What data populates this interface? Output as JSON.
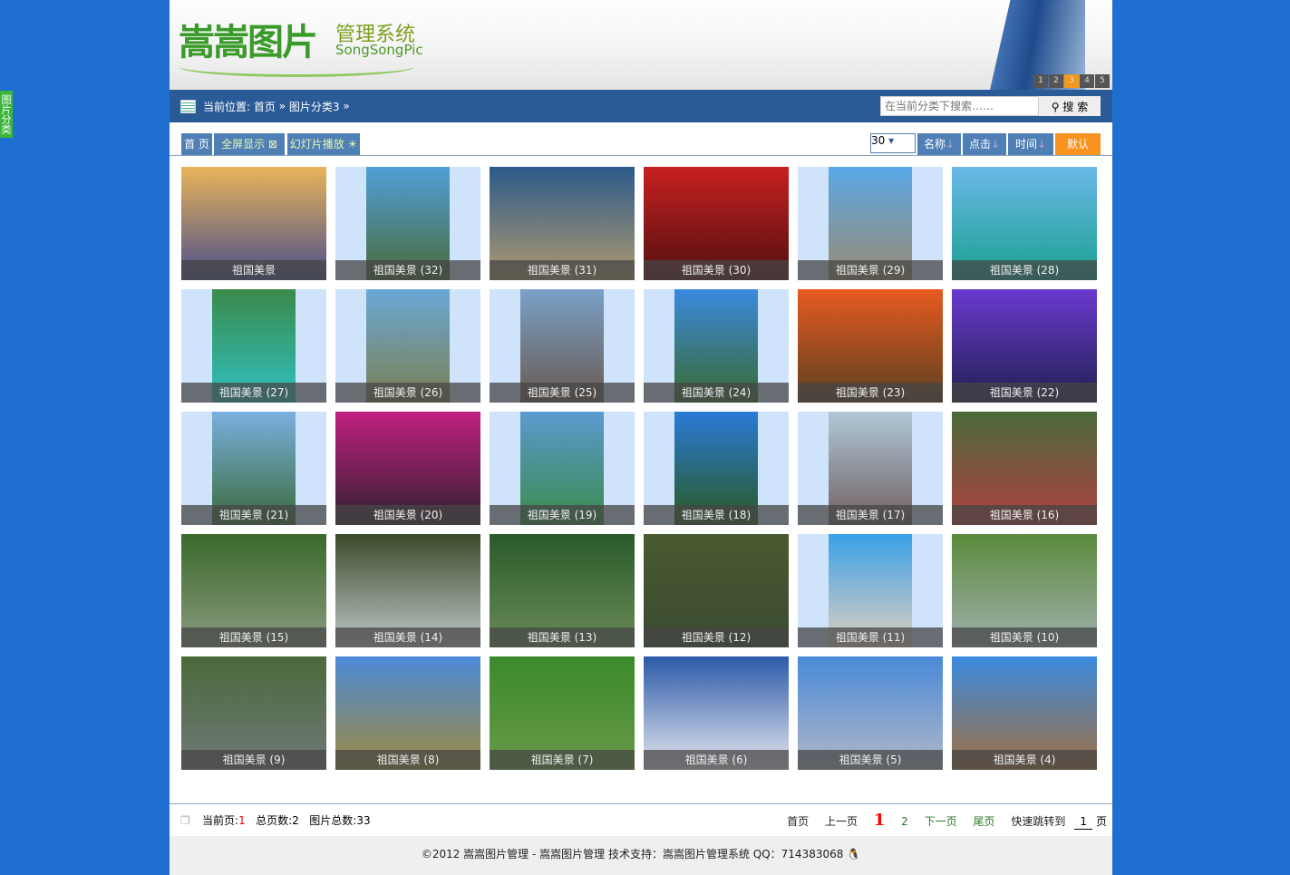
{
  "sidebar_tab": "图片分类",
  "header": {
    "logo_cn": "嵩嵩图片",
    "logo_sub": "管理系统",
    "logo_en": "SongSongPic",
    "banner_pages": [
      "1",
      "2",
      "3",
      "4",
      "5"
    ],
    "active_banner": "3"
  },
  "nav": {
    "location_label": "当前位置:",
    "home": "首页",
    "sep": "»",
    "category": "图片分类3",
    "search_placeholder": "在当前分类下搜索……",
    "search_button": "搜 索"
  },
  "toolbar": {
    "home": "首 页",
    "fullscreen": "全屏显示 ⊠",
    "slideshow": "幻灯片播放 ☀",
    "per_page": "30",
    "sort_name": "名称",
    "sort_clicks": "点击",
    "sort_time": "时间",
    "sort_default": "默认"
  },
  "photos": [
    {
      "caption": "祖国美景",
      "portrait": false,
      "c1": "#e9b45a",
      "c2": "#4a4e8a"
    },
    {
      "caption": "祖国美景 (32)",
      "portrait": true,
      "c1": "#4fa0d8",
      "c2": "#4a6a3a"
    },
    {
      "caption": "祖国美景 (31)",
      "portrait": false,
      "c1": "#2b5a8a",
      "c2": "#b09a70"
    },
    {
      "caption": "祖国美景 (30)",
      "portrait": false,
      "c1": "#c82020",
      "c2": "#501010"
    },
    {
      "caption": "祖国美景 (29)",
      "portrait": true,
      "c1": "#5aa8e8",
      "c2": "#9a8a70"
    },
    {
      "caption": "祖国美景 (28)",
      "portrait": false,
      "c1": "#6ab8e8",
      "c2": "#1aa090"
    },
    {
      "caption": "祖国美景 (27)",
      "portrait": true,
      "c1": "#3a8a4a",
      "c2": "#30c0c0"
    },
    {
      "caption": "祖国美景 (26)",
      "portrait": true,
      "c1": "#6aa8d8",
      "c2": "#7a8050"
    },
    {
      "caption": "祖国美景 (25)",
      "portrait": true,
      "c1": "#7aa0c8",
      "c2": "#6a5a50"
    },
    {
      "caption": "祖国美景 (24)",
      "portrait": true,
      "c1": "#3a8ae0",
      "c2": "#3a6a30"
    },
    {
      "caption": "祖国美景 (23)",
      "portrait": false,
      "c1": "#e85a20",
      "c2": "#5a4020"
    },
    {
      "caption": "祖国美景 (22)",
      "portrait": false,
      "c1": "#6a3ad0",
      "c2": "#202050"
    },
    {
      "caption": "祖国美景 (21)",
      "portrait": true,
      "c1": "#7ab0e0",
      "c2": "#3a6a3a"
    },
    {
      "caption": "祖国美景 (20)",
      "portrait": false,
      "c1": "#c02080",
      "c2": "#302030"
    },
    {
      "caption": "祖国美景 (19)",
      "portrait": true,
      "c1": "#5a9ad0",
      "c2": "#3a8a4a"
    },
    {
      "caption": "祖国美景 (18)",
      "portrait": true,
      "c1": "#2a7ad8",
      "c2": "#2a5a20"
    },
    {
      "caption": "祖国美景 (17)",
      "portrait": true,
      "c1": "#b0c8d8",
      "c2": "#706060"
    },
    {
      "caption": "祖国美景 (16)",
      "portrait": false,
      "c1": "#4a6a3a",
      "c2": "#b04040"
    },
    {
      "caption": "祖国美景 (15)",
      "portrait": false,
      "c1": "#3a6a2a",
      "c2": "#8a9a80"
    },
    {
      "caption": "祖国美景 (14)",
      "portrait": false,
      "c1": "#3a4a2a",
      "c2": "#c0c8c8"
    },
    {
      "caption": "祖国美景 (13)",
      "portrait": false,
      "c1": "#2a5a2a",
      "c2": "#6a8a5a"
    },
    {
      "caption": "祖国美景 (12)",
      "portrait": false,
      "c1": "#4a5a30",
      "c2": "#3a4a30"
    },
    {
      "caption": "祖国美景 (11)",
      "portrait": true,
      "c1": "#3aa0e8",
      "c2": "#e0d0c0"
    },
    {
      "caption": "祖国美景 (10)",
      "portrait": false,
      "c1": "#5a8a3a",
      "c2": "#a0b0b0"
    },
    {
      "caption": "祖国美景 (9)",
      "portrait": false,
      "c1": "#4a6a3a",
      "c2": "#707878"
    },
    {
      "caption": "祖国美景 (8)",
      "portrait": false,
      "c1": "#4a8ad8",
      "c2": "#a08a40"
    },
    {
      "caption": "祖国美景 (7)",
      "portrait": false,
      "c1": "#3a8a2a",
      "c2": "#6a9a4a"
    },
    {
      "caption": "祖国美景 (6)",
      "portrait": false,
      "c1": "#2a5aa8",
      "c2": "#e8e8f0"
    },
    {
      "caption": "祖国美景 (5)",
      "portrait": false,
      "c1": "#4a8ad8",
      "c2": "#b0b8c8"
    },
    {
      "caption": "祖国美景 (4)",
      "portrait": false,
      "c1": "#3a8ae0",
      "c2": "#a07040"
    }
  ],
  "pager": {
    "current_label": "当前页:",
    "current": "1",
    "total_pages": "总页数:2",
    "total_images": "图片总数:33",
    "first": "首页",
    "prev": "上一页",
    "page1": "1",
    "page2": "2",
    "next": "下一页",
    "last": "尾页",
    "jump_label": "快速跳转到",
    "jump_value": "1",
    "jump_unit": "页"
  },
  "footer": {
    "text": "©2012 嵩嵩图片管理 - 嵩嵩图片管理 技术支持：嵩嵩图片管理系统 QQ：714383068"
  }
}
